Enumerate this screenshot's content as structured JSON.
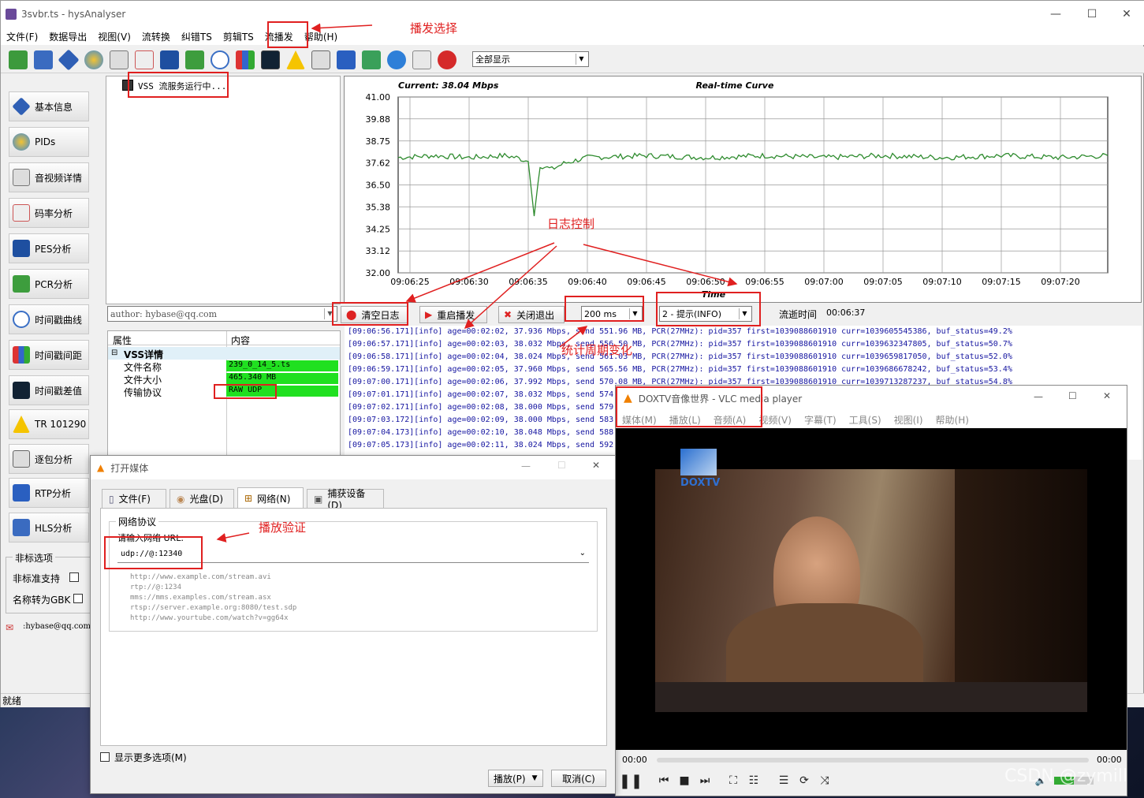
{
  "app": {
    "title": "3svbr.ts - hysAnalyser",
    "menu": [
      "文件(F)",
      "数据导出",
      "视图(V)",
      "流转换",
      "纠错TS",
      "剪辑TS",
      "流播发",
      "帮助(H)"
    ],
    "display_select": "全部显示",
    "status": "就绪"
  },
  "sidebar": {
    "items": [
      "基本信息",
      "PIDs",
      "音视频详情",
      "码率分析",
      "PES分析",
      "PCR分析",
      "时间戳曲线",
      "时间戳间距",
      "时间戳差值",
      "TR 101290",
      "逐包分析",
      "RTP分析",
      "HLS分析"
    ],
    "nonstd_group": "非标选项",
    "nonstd_support": "非标准支持",
    "gbk": "名称转为GBK",
    "email": ":hybase@qq.com"
  },
  "tree": {
    "node": "VSS 流服务运行中..."
  },
  "chart": {
    "current": "Current: 38.04 Mbps",
    "title": "Real-time Curve",
    "xlabel": "Time"
  },
  "chart_data": {
    "type": "line",
    "title": "Real-time Curve",
    "xlabel": "Time",
    "ylabel": "",
    "ylim": [
      32.0,
      41.0
    ],
    "yticks": [
      "41.00",
      "39.88",
      "38.75",
      "37.62",
      "36.50",
      "35.38",
      "34.25",
      "33.12",
      "32.00"
    ],
    "xticks": [
      "09:06:25",
      "09:06:30",
      "09:06:35",
      "09:06:40",
      "09:06:45",
      "09:06:50",
      "09:06:55",
      "09:07:00",
      "09:07:05",
      "09:07:10",
      "09:07:15",
      "09:07:20"
    ],
    "series": [
      {
        "color": "#2e8b2e",
        "x": [
          "09:06:24",
          "09:06:27",
          "09:06:30",
          "09:06:33",
          "09:06:34",
          "09:06:35",
          "09:06:35.5",
          "09:06:36",
          "09:06:37",
          "09:06:38",
          "09:06:40",
          "09:06:45",
          "09:06:50",
          "09:06:55",
          "09:07:00",
          "09:07:05",
          "09:07:10",
          "09:07:15",
          "09:07:20",
          "09:07:24"
        ],
        "values": [
          37.9,
          38.0,
          37.9,
          38.0,
          37.9,
          37.7,
          34.9,
          37.5,
          37.3,
          37.6,
          37.9,
          38.0,
          37.9,
          38.0,
          37.9,
          38.0,
          37.9,
          38.0,
          37.9,
          38.0
        ]
      }
    ]
  },
  "controls": {
    "author": "author: hybase@qq.com",
    "clear_log": "清空日志",
    "restart": "重启播发",
    "close_exit": "关闭退出",
    "interval": "200 ms",
    "log_level": "2 - 提示(INFO)",
    "elapsed_label": "流逝时间",
    "elapsed_value": "00:06:37"
  },
  "props": {
    "col_attr": "属性",
    "col_val": "内容",
    "group": "VSS详情",
    "rows": [
      {
        "k": "文件名称",
        "v": "239_0_14_5.ts"
      },
      {
        "k": "文件大小",
        "v": "465.340 MB"
      },
      {
        "k": "传输协议",
        "v": "RAW UDP"
      }
    ]
  },
  "log": [
    "[09:06:56.171][info] age=00:02:02, 37.936 Mbps, send 551.96 MB, PCR(27MHz): pid=357 first=1039088601910 curr=1039605545386, buf_status=49.2%",
    "[09:06:57.171][info] age=00:02:03, 38.032 Mbps, send 556.50 MB, PCR(27MHz): pid=357 first=1039088601910 curr=1039632347805, buf_status=50.7%",
    "[09:06:58.171][info] age=00:02:04, 38.024 Mbps, send 561.03 MB, PCR(27MHz): pid=357 first=1039088601910 curr=1039659817050, buf_status=52.0%",
    "[09:06:59.171][info] age=00:02:05, 37.960 Mbps, send 565.56 MB, PCR(27MHz): pid=357 first=1039088601910 curr=1039686678242, buf_status=53.4%",
    "[09:07:00.171][info] age=00:02:06, 37.992 Mbps, send 570.08 MB, PCR(27MHz): pid=357 first=1039088601910 curr=1039713287237, buf_status=54.8%",
    "[09:07:01.171][info] age=00:02:07, 38.032 Mbps, send 574.",
    "[09:07:02.171][info] age=00:02:08, 38.000 Mbps, send 579.",
    "[09:07:03.172][info] age=00:02:09, 38.000 Mbps, send 583.",
    "[09:07:04.173][info] age=00:02:10, 38.048 Mbps, send 588.",
    "[09:07:05.173][info] age=00:02:11, 38.024 Mbps, send 592."
  ],
  "vlc": {
    "title": "DOXTV音像世界 - VLC media player",
    "menu": [
      "媒体(M)",
      "播放(L)",
      "音频(A)",
      "视频(V)",
      "字幕(T)",
      "工具(S)",
      "视图(I)",
      "帮助(H)"
    ],
    "logo": "DOXTV",
    "time_left": "00:00",
    "time_right": "00:00"
  },
  "dialog": {
    "title": "打开媒体",
    "tabs": [
      "文件(F)",
      "光盘(D)",
      "网络(N)",
      "捕获设备(D)"
    ],
    "group": "网络协议",
    "url_label": "请输入网络 URL:",
    "url_value": "udp://@:12340",
    "examples": [
      "http://www.example.com/stream.avi",
      "rtp://@:1234",
      "mms://mms.examples.com/stream.asx",
      "rtsp://server.example.org:8080/test.sdp",
      "http://www.yourtube.com/watch?v=gg64x"
    ],
    "more_options": "显示更多选项(M)",
    "play": "播放(P)",
    "cancel": "取消(C)"
  },
  "annotations": {
    "bcast": "播发选择",
    "logctl": "日志控制",
    "period": "统计周期变化",
    "verify": "播放验证"
  },
  "watermark": "CSDN @zymill"
}
